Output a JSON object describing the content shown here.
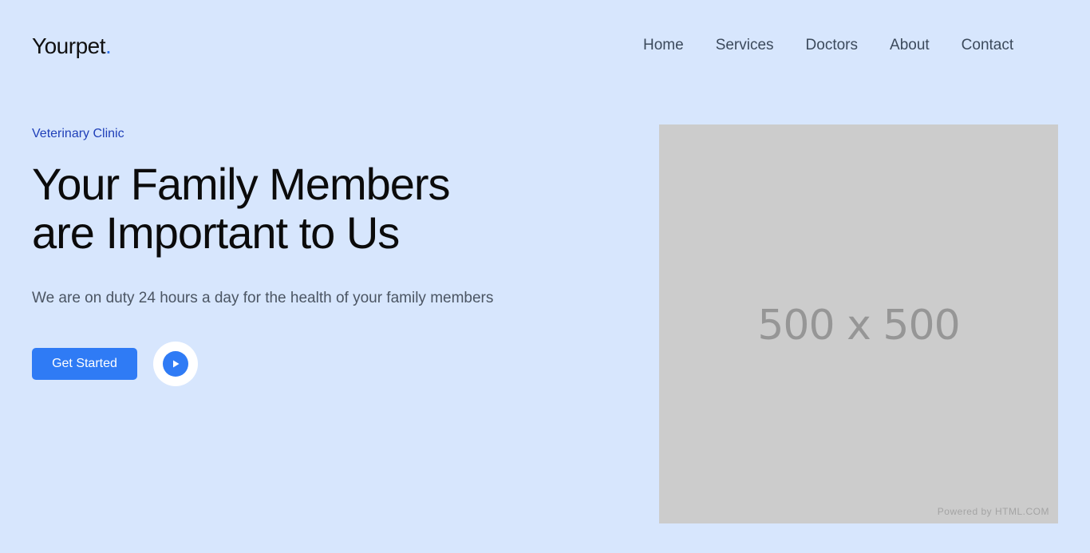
{
  "brand": {
    "name": "Yourpet",
    "dot": "."
  },
  "nav": {
    "items": [
      {
        "label": "Home"
      },
      {
        "label": "Services"
      },
      {
        "label": "Doctors"
      },
      {
        "label": "About"
      },
      {
        "label": "Contact"
      }
    ]
  },
  "hero": {
    "eyebrow": "Veterinary Clinic",
    "headline_line1": "Your Family Members",
    "headline_line2": "are Important to Us",
    "subtitle": "We are on duty 24 hours a day for the health of your family members",
    "cta_label": "Get Started",
    "play_icon": "play-icon"
  },
  "image_placeholder": {
    "size_text": "500 x 500",
    "credit": "Powered by HTML.COM"
  },
  "colors": {
    "background": "#d7e6fd",
    "accent": "#2f7bf5",
    "eyebrow": "#1f3fb8"
  }
}
